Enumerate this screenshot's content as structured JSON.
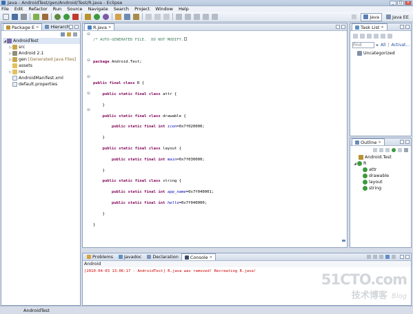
{
  "window": {
    "title": "Java - AndroidTest/gen/Android/Test/R.java - Eclipse"
  },
  "menu": [
    "File",
    "Edit",
    "Refactor",
    "Run",
    "Source",
    "Navigate",
    "Search",
    "Project",
    "Window",
    "Help"
  ],
  "perspectives": [
    "Java",
    "Java EE"
  ],
  "package_explorer": {
    "tabs": [
      "Package E",
      "Hierarchy"
    ],
    "tree": [
      {
        "label": "AndroidTest",
        "depth": 0,
        "expanded": true
      },
      {
        "label": "src",
        "depth": 1,
        "expanded": false
      },
      {
        "label": "Android 2.1",
        "depth": 1,
        "expanded": false
      },
      {
        "label": "gen",
        "depth": 1,
        "expanded": false,
        "decoration": "[Generated Java Files]"
      },
      {
        "label": "assets",
        "depth": 1
      },
      {
        "label": "res",
        "depth": 1,
        "expanded": false
      },
      {
        "label": "AndroidManifest.xml",
        "depth": 1
      },
      {
        "label": "default.properties",
        "depth": 1
      }
    ]
  },
  "editor": {
    "tab": "R.java",
    "lines": [
      "/* AUTO-GENERATED FILE.  DO NOT MODIFY.",
      "",
      "package Android.Test;",
      "",
      "public final class R {",
      "    public static final class attr {",
      "    }",
      "    public static final class drawable {",
      "        public static final int icon=0x7f020000;",
      "    }",
      "    public static final class layout {",
      "        public static final int main=0x7f030000;",
      "    }",
      "    public static final class string {",
      "        public static final int app_name=0x7f040001;",
      "        public static final int hello=0x7f040000;",
      "    }",
      "}"
    ]
  },
  "task_list": {
    "tab": "Task List",
    "find_placeholder": "Find",
    "all_label": "All",
    "activate_label": "Activat...",
    "category": "Uncategorized"
  },
  "outline": {
    "tab": "Outline",
    "items": [
      {
        "label": "Android.Test",
        "depth": 0
      },
      {
        "label": "R",
        "depth": 0
      },
      {
        "label": "attr",
        "depth": 1
      },
      {
        "label": "drawable",
        "depth": 1
      },
      {
        "label": "layout",
        "depth": 1
      },
      {
        "label": "string",
        "depth": 1
      }
    ]
  },
  "bottom": {
    "tabs": [
      "Problems",
      "Javadoc",
      "Declaration",
      "Console"
    ],
    "console_title": "Android",
    "console_line": "[2010-04-03 13:06:17 - AndroidTest] R.java was removed! Recreating R.java!"
  },
  "watermark": {
    "main": "51CTO.com",
    "sub": "技术博客",
    "blog": "Blog"
  },
  "status": {
    "text": "AndroidTest"
  },
  "colors": {
    "keyword": "#7f0055",
    "comment": "#3f7f5f",
    "field": "#0000c0",
    "console_error": "#cc0000"
  }
}
